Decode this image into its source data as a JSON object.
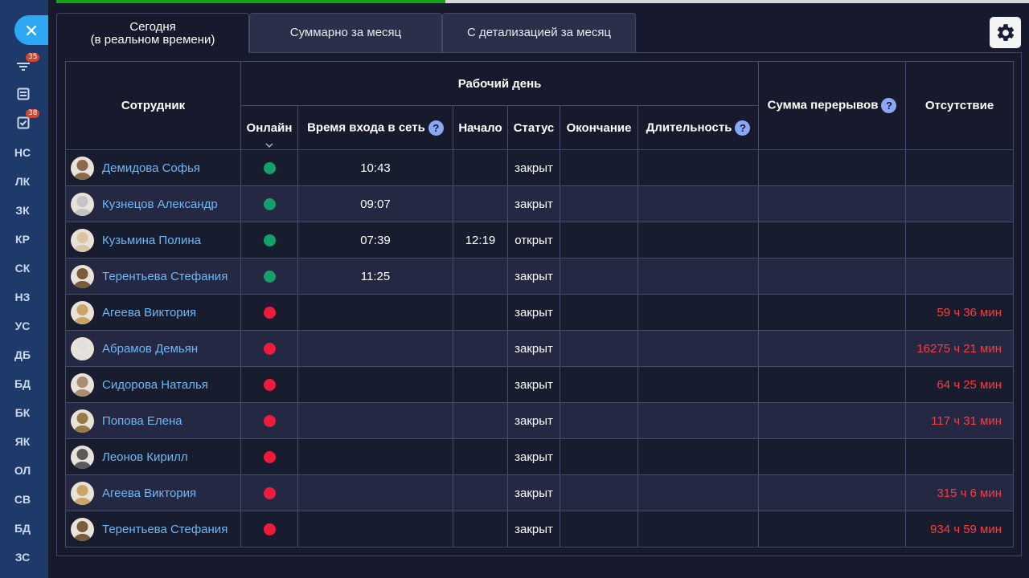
{
  "sidebar": {
    "close_icon": "close-icon",
    "filter_badge": "35",
    "tasks_badge": "38",
    "items": [
      "НС",
      "ЛК",
      "ЗК",
      "КР",
      "СК",
      "НЗ",
      "УС",
      "ДБ",
      "БД",
      "БК",
      "ЯК",
      "ОЛ",
      "СВ",
      "БД",
      "ЗС"
    ]
  },
  "progress": 0.4,
  "tabs": {
    "today_line1": "Сегодня",
    "today_line2": "(в реальном времени)",
    "month_total": "Суммарно за месяц",
    "month_detail": "С детализацией за месяц"
  },
  "table": {
    "headers": {
      "employee": "Сотрудник",
      "workday": "Рабочий день",
      "online": "Онлайн",
      "login_time": "Время входа в сеть",
      "start": "Начало",
      "status": "Статус",
      "end": "Окончание",
      "duration": "Длительность",
      "breaks": "Сумма перерывов",
      "absence": "Отсутствие",
      "help": "?"
    },
    "rows": [
      {
        "name": "Демидова Софья",
        "online": true,
        "login": "10:43",
        "start": "",
        "status": "закрыт",
        "end": "",
        "duration": "",
        "breaks": "",
        "absence": ""
      },
      {
        "name": "Кузнецов Александр",
        "online": true,
        "login": "09:07",
        "start": "",
        "status": "закрыт",
        "end": "",
        "duration": "",
        "breaks": "",
        "absence": ""
      },
      {
        "name": "Кузьмина Полина",
        "online": true,
        "login": "07:39",
        "start": "12:19",
        "status": "открыт",
        "end": "",
        "duration": "",
        "breaks": "",
        "absence": ""
      },
      {
        "name": "Терентьева Стефания",
        "online": true,
        "login": "11:25",
        "start": "",
        "status": "закрыт",
        "end": "",
        "duration": "",
        "breaks": "",
        "absence": ""
      },
      {
        "name": "Агеева Виктория",
        "online": false,
        "login": "",
        "start": "",
        "status": "закрыт",
        "end": "",
        "duration": "",
        "breaks": "",
        "absence": "59 ч 36 мин"
      },
      {
        "name": "Абрамов Демьян",
        "online": false,
        "login": "",
        "start": "",
        "status": "закрыт",
        "end": "",
        "duration": "",
        "breaks": "",
        "absence": "16275 ч 21 мин"
      },
      {
        "name": "Сидорова Наталья",
        "online": false,
        "login": "",
        "start": "",
        "status": "закрыт",
        "end": "",
        "duration": "",
        "breaks": "",
        "absence": "64 ч 25 мин"
      },
      {
        "name": "Попова Елена",
        "online": false,
        "login": "",
        "start": "",
        "status": "закрыт",
        "end": "",
        "duration": "",
        "breaks": "",
        "absence": "117 ч 31 мин"
      },
      {
        "name": "Леонов Кирилл",
        "online": false,
        "login": "",
        "start": "",
        "status": "закрыт",
        "end": "",
        "duration": "",
        "breaks": "",
        "absence": ""
      },
      {
        "name": "Агеева Виктория",
        "online": false,
        "login": "",
        "start": "",
        "status": "закрыт",
        "end": "",
        "duration": "",
        "breaks": "",
        "absence": "315 ч  6 мин"
      },
      {
        "name": "Терентьева Стефания",
        "online": false,
        "login": "",
        "start": "",
        "status": "закрыт",
        "end": "",
        "duration": "",
        "breaks": "",
        "absence": "934 ч 59 мин"
      }
    ]
  },
  "colors": {
    "online": "#13a06b",
    "offline": "#ee1c3c",
    "absence_text": "#ff3b3b",
    "name_link": "#6fb7f5",
    "avatar_palette": [
      "#8a6a4f",
      "#c4c4c4",
      "#d9c6a3",
      "#7a5c3a",
      "#c9a46b",
      "#e0e0e0",
      "#a98d72",
      "#9b7a4a",
      "#5a5a5a",
      "#c9a46b",
      "#7a5c3a"
    ]
  }
}
